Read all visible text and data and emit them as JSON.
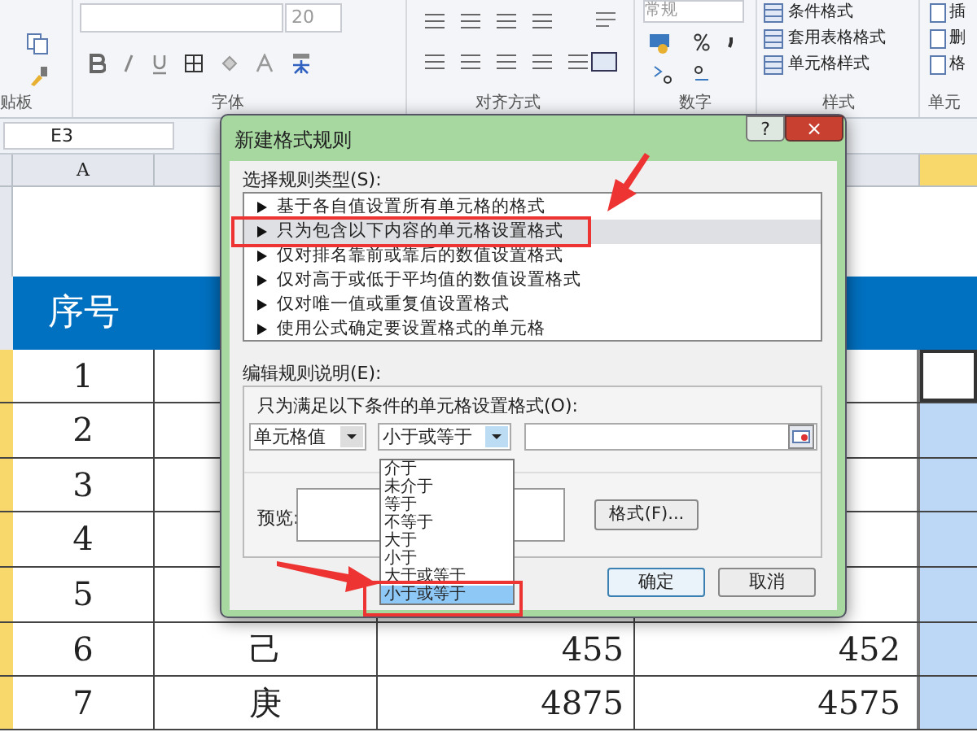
{
  "ribbon": {
    "font_size": "20",
    "number_format": "常规",
    "style_buttons": [
      "条件格式",
      "套用表格格式",
      "单元格样式"
    ],
    "cell_buttons": [
      "插",
      "删",
      "格"
    ],
    "groups": [
      "贴板",
      "字体",
      "对齐方式",
      "数字",
      "样式",
      "单元"
    ]
  },
  "name_box": "E3",
  "column_header": "A",
  "table": {
    "header": "序号",
    "rows": [
      {
        "no": "1"
      },
      {
        "no": "2"
      },
      {
        "no": "3"
      },
      {
        "no": "4"
      },
      {
        "no": "5"
      },
      {
        "no": "6",
        "name": "己",
        "c": "455",
        "d": "452"
      },
      {
        "no": "7",
        "name": "庚",
        "c": "4875",
        "d": "4575"
      }
    ]
  },
  "dialog": {
    "title": "新建格式规则",
    "help": "?",
    "close": "×",
    "rule_type_label": "选择规则类型(S):",
    "rule_types": [
      {
        "label": "基于各自值设置所有单元格的格式",
        "selected": false
      },
      {
        "label": "只为包含以下内容的单元格设置格式",
        "selected": true
      },
      {
        "label": "仅对排名靠前或靠后的数值设置格式",
        "selected": false
      },
      {
        "label": "仅对高于或低于平均值的数值设置格式",
        "selected": false
      },
      {
        "label": "仅对唯一值或重复值设置格式",
        "selected": false
      },
      {
        "label": "使用公式确定要设置格式的单元格",
        "selected": false
      }
    ],
    "edit_label": "编辑规则说明(E):",
    "condition_label": "只为满足以下条件的单元格设置格式(O):",
    "field_select": "单元格值",
    "operator_select": "小于或等于",
    "operator_options": [
      {
        "label": "介于",
        "selected": false
      },
      {
        "label": "未介于",
        "selected": false
      },
      {
        "label": "等于",
        "selected": false
      },
      {
        "label": "不等于",
        "selected": false
      },
      {
        "label": "大于",
        "selected": false
      },
      {
        "label": "小于",
        "selected": false
      },
      {
        "label": "大于或等于",
        "selected": false
      },
      {
        "label": "小于或等于",
        "selected": true
      }
    ],
    "preview_label": "预览:",
    "format_button": "格式(F)...",
    "ok": "确定",
    "cancel": "取消"
  }
}
